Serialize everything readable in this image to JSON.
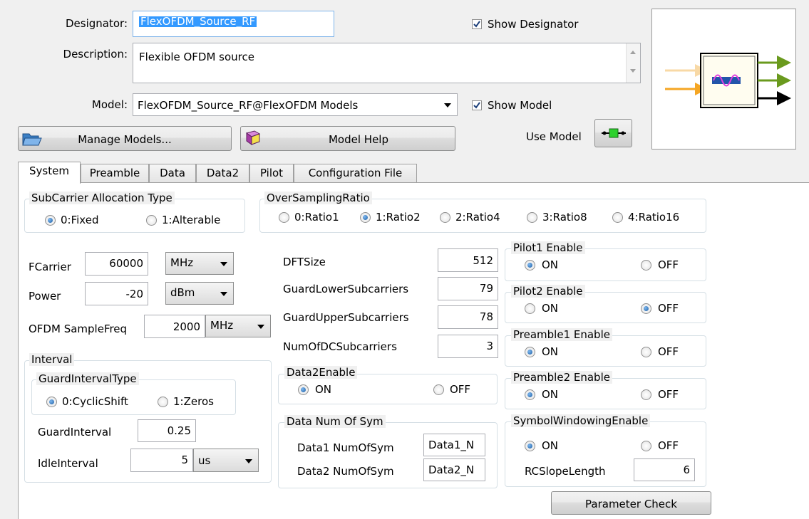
{
  "header": {
    "designator_label": "Designator:",
    "designator_value": "FlexOFDM_Source_RF",
    "show_designator_label": "Show Designator",
    "description_label": "Description:",
    "description_value": "Flexible OFDM source",
    "model_label": "Model:",
    "model_value": "FlexOFDM_Source_RF@FlexOFDM Models",
    "show_model_label": "Show Model",
    "manage_models_label": "Manage Models...",
    "model_help_label": "Model Help",
    "use_model_label": "Use Model"
  },
  "tabs": [
    "System",
    "Preamble",
    "Data",
    "Data2",
    "Pilot",
    "Configuration File"
  ],
  "system": {
    "subcarrier_alloc": {
      "title": "SubCarrier Allocation Type",
      "options": [
        "0:Fixed",
        "1:Alterable"
      ],
      "selected": 0
    },
    "oversampling": {
      "title": "OverSamplingRatio",
      "options": [
        "0:Ratio1",
        "1:Ratio2",
        "2:Ratio4",
        "3:Ratio8",
        "4:Ratio16"
      ],
      "selected": 1
    },
    "fcarrier": {
      "label": "FCarrier",
      "value": "60000",
      "unit": "MHz"
    },
    "power": {
      "label": "Power",
      "value": "-20",
      "unit": "dBm"
    },
    "samplefreq": {
      "label": "OFDM SampleFreq",
      "value": "2000",
      "unit": "MHz"
    },
    "interval": {
      "title": "Interval",
      "guard_type": {
        "title": "GuardIntervalType",
        "options": [
          "0:CyclicShift",
          "1:Zeros"
        ],
        "selected": 0
      },
      "guard_interval": {
        "label": "GuardInterval",
        "value": "0.25"
      },
      "idle_interval": {
        "label": "IdleInterval",
        "value": "5",
        "unit": "us"
      }
    },
    "dftsize": {
      "label": "DFTSize",
      "value": "512"
    },
    "guard_lower": {
      "label": "GuardLowerSubcarriers",
      "value": "79"
    },
    "guard_upper": {
      "label": "GuardUpperSubcarriers",
      "value": "78"
    },
    "num_dc": {
      "label": "NumOfDCSubcarriers",
      "value": "3"
    },
    "data2enable": {
      "title": "Data2Enable",
      "on": "ON",
      "off": "OFF",
      "state": "on"
    },
    "data_num_sym": {
      "title": "Data Num Of Sym",
      "data1_label": "Data1 NumOfSym",
      "data1_value": "Data1_N",
      "data2_label": "Data2 NumOfSym",
      "data2_value": "Data2_N"
    },
    "pilot1": {
      "title": "Pilot1 Enable",
      "on": "ON",
      "off": "OFF",
      "state": "on"
    },
    "pilot2": {
      "title": "Pilot2 Enable",
      "on": "ON",
      "off": "OFF",
      "state": "off"
    },
    "preamble1": {
      "title": "Preamble1 Enable",
      "on": "ON",
      "off": "OFF",
      "state": "on"
    },
    "preamble2": {
      "title": "Preamble2 Enable",
      "on": "ON",
      "off": "OFF",
      "state": "on"
    },
    "symbol_windowing": {
      "title": "SymbolWindowingEnable",
      "on": "ON",
      "off": "OFF",
      "state": "on",
      "rcslope_label": "RCSlopeLength",
      "rcslope_value": "6"
    },
    "parameter_check_label": "Parameter Check"
  },
  "icons": {
    "manage_models": "folder-open-icon",
    "model_help": "help-book-icon",
    "use_model": "component-symbol-icon",
    "preview": "block-symbol-preview"
  },
  "colors": {
    "selection": "#3399ff",
    "radio_dot": "#1d5fa5",
    "arrow_green": "#6a9a1e",
    "arrow_orange": "#f5a623"
  }
}
